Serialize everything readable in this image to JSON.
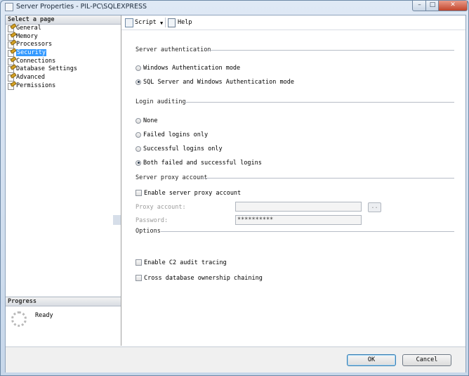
{
  "window": {
    "title": "Server Properties - PIL-PC\\SQLEXPRESS",
    "min": "–",
    "max": "□",
    "close": "✕"
  },
  "left": {
    "header": "Select a page",
    "pages": [
      "General",
      "Memory",
      "Processors",
      "Security",
      "Connections",
      "Database Settings",
      "Advanced",
      "Permissions"
    ],
    "selected_index": 3,
    "progress_header": "Progress",
    "progress_status": "Ready"
  },
  "toolbar": {
    "script_label": "Script",
    "dropdown_glyph": "▼",
    "help_label": "Help"
  },
  "server_auth": {
    "title": "Server authentication",
    "options": [
      "Windows Authentication mode",
      "SQL Server and Windows Authentication mode"
    ],
    "selected": 1
  },
  "login_auditing": {
    "title": "Login auditing",
    "options": [
      "None",
      "Failed logins only",
      "Successful logins only",
      "Both failed and successful logins"
    ],
    "selected": 3
  },
  "proxy": {
    "title": "Server proxy account",
    "enable_label": "Enable server proxy account",
    "enable_checked": false,
    "account_label": "Proxy account:",
    "account_value": "",
    "password_label": "Password:",
    "password_value": "**********",
    "browse_label": ".."
  },
  "options": {
    "title": "Options",
    "c2_label": "Enable C2 audit tracing",
    "c2_checked": false,
    "cross_db_label": "Cross database ownership chaining",
    "cross_db_checked": false
  },
  "buttons": {
    "ok": "OK",
    "cancel": "Cancel"
  }
}
